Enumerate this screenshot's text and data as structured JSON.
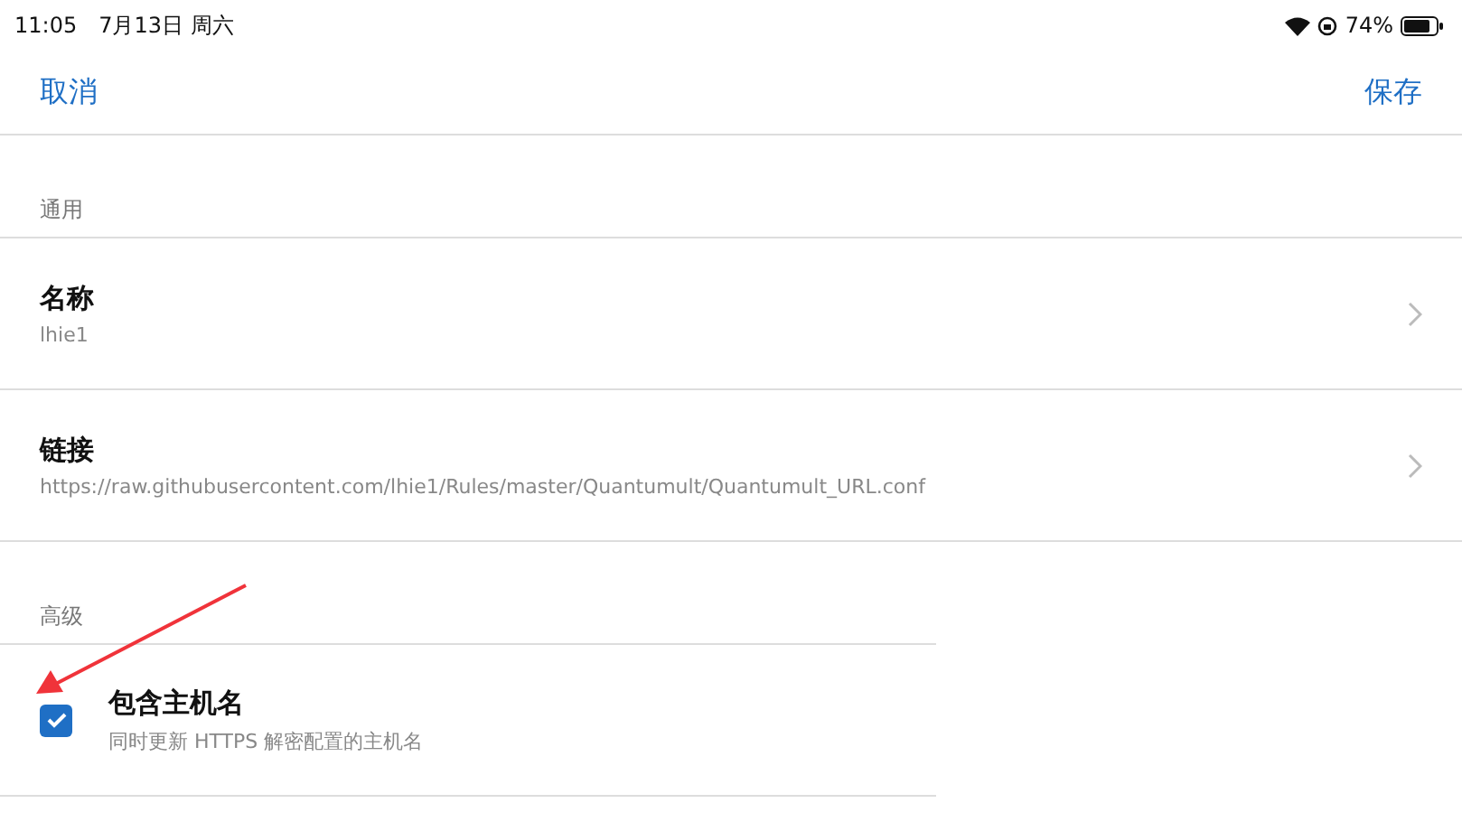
{
  "status_bar": {
    "time": "11:05",
    "date": "7月13日 周六",
    "battery": "74%"
  },
  "nav": {
    "cancel": "取消",
    "save": "保存"
  },
  "sections": [
    {
      "header": "通用",
      "kind": "links",
      "rows": [
        {
          "title": "名称",
          "subtitle": "lhie1"
        },
        {
          "title": "链接",
          "subtitle": "https://raw.githubusercontent.com/lhie1/Rules/master/Quantumult/Quantumult_URL.conf"
        }
      ]
    },
    {
      "header": "高级",
      "kind": "checks",
      "rows": [
        {
          "title": "包含主机名",
          "subtitle": "同时更新 HTTPS 解密配置的主机名",
          "checked": true
        }
      ]
    }
  ]
}
